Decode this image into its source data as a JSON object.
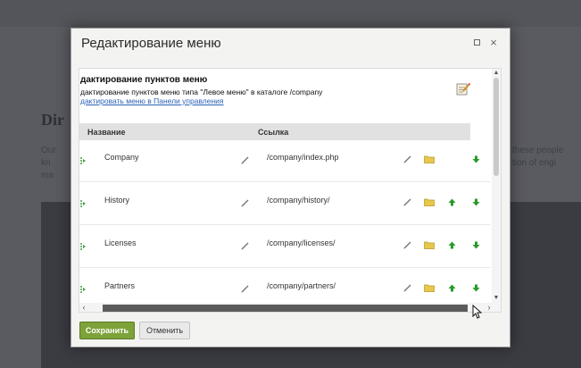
{
  "background": {
    "heading": "Dir",
    "text_left": "Our\nkn\nma",
    "text_right": "these people\ntion of engi"
  },
  "dialog": {
    "title": "Редактирование меню",
    "close_symbol": "×"
  },
  "info": {
    "title": "дактирование пунктов меню",
    "description": "дактирование пунктов меню типа \"Левое меню\" в каталоге /company",
    "link": "дактировать меню в Панели управления"
  },
  "table": {
    "headers": {
      "name": "Название",
      "link": "Ссылка"
    },
    "rows": [
      {
        "name": "Company",
        "link": "/company/index.php"
      },
      {
        "name": "History",
        "link": "/company/history/"
      },
      {
        "name": "Licenses",
        "link": "/company/licenses/"
      },
      {
        "name": "Partners",
        "link": "/company/partners/"
      }
    ]
  },
  "scrollbars": {
    "up": "▲",
    "down": "▼",
    "left": "‹",
    "right": "›"
  },
  "buttons": {
    "save": "Сохранить",
    "cancel": "Отменить"
  },
  "colors": {
    "save_button": "#7da23a",
    "link": "#2c62b8",
    "arrow_green": "#2a9a2a",
    "folder_yellow": "#e8c84a"
  },
  "icons": {
    "drag": "drag-handle-icon",
    "edit": "pencil-icon",
    "folder": "folder-icon",
    "move_up": "arrow-up-icon",
    "move_down": "arrow-down-icon",
    "menu_editor": "notepad-icon"
  }
}
